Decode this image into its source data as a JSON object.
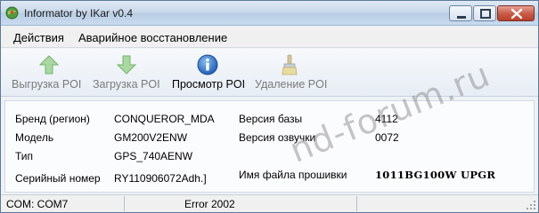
{
  "window": {
    "title": "Informator by IKar v0.4",
    "icon": "globe-pin-icon"
  },
  "menu": {
    "items": [
      {
        "label": "Действия"
      },
      {
        "label": "Аварийное восстановление"
      }
    ]
  },
  "toolbar": {
    "items": [
      {
        "label": "Выгрузка POI",
        "icon": "arrow-up-icon",
        "enabled": false
      },
      {
        "label": "Загрузка POI",
        "icon": "arrow-down-icon",
        "enabled": false
      },
      {
        "label": "Просмотр POI",
        "icon": "info-icon",
        "enabled": true
      },
      {
        "label": "Удаление POI",
        "icon": "brush-icon",
        "enabled": false
      }
    ]
  },
  "info": {
    "brand_label": "Бренд (регион)",
    "brand_value": "CONQUEROR_MDA",
    "model_label": "Модель",
    "model_value": "GM200V2ENW",
    "type_label": "Тип",
    "type_value": "GPS_740AENW",
    "serial_label": "Серийный номер",
    "serial_value": "RY110906072Adh.]",
    "db_version_label": "Версия базы",
    "db_version_value": "4112",
    "voice_version_label": "Версия озвучки",
    "voice_version_value": "0072",
    "firmware_label": "Имя файла прошивки",
    "firmware_value": "1011BG100W UPGR"
  },
  "status": {
    "port": "COM: COM7",
    "error": "Error 2002"
  },
  "watermark": "nd-forum.ru",
  "colors": {
    "arrow_disabled": "#8fc78a",
    "info_blue": "#2f6fc4",
    "close_red": "#c85a45"
  }
}
